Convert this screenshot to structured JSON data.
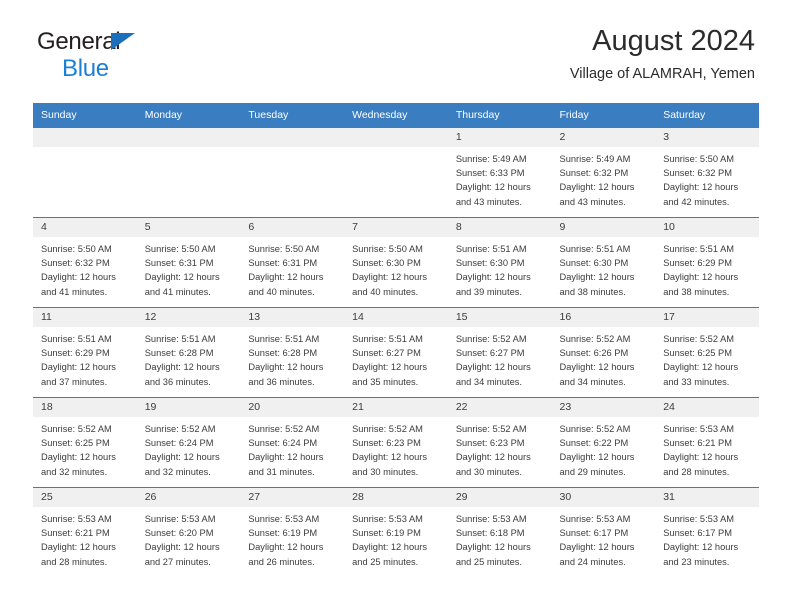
{
  "brand": {
    "name_part1": "General",
    "name_part2": "Blue",
    "accent_color": "#1c7fd6",
    "triangle_color": "#1c6fba"
  },
  "header": {
    "title": "August 2024",
    "subtitle": "Village of ALAMRAH, Yemen"
  },
  "calendar": {
    "header_bg": "#3a7dc0",
    "daynum_bg": "#f0f0f0",
    "weekday_headers": [
      "Sunday",
      "Monday",
      "Tuesday",
      "Wednesday",
      "Thursday",
      "Friday",
      "Saturday"
    ],
    "weeks": [
      [
        {
          "day": "",
          "sunrise": "",
          "sunset": "",
          "daylight1": "",
          "daylight2": "",
          "empty": true
        },
        {
          "day": "",
          "sunrise": "",
          "sunset": "",
          "daylight1": "",
          "daylight2": "",
          "empty": true
        },
        {
          "day": "",
          "sunrise": "",
          "sunset": "",
          "daylight1": "",
          "daylight2": "",
          "empty": true
        },
        {
          "day": "",
          "sunrise": "",
          "sunset": "",
          "daylight1": "",
          "daylight2": "",
          "empty": true
        },
        {
          "day": "1",
          "sunrise": "Sunrise: 5:49 AM",
          "sunset": "Sunset: 6:33 PM",
          "daylight1": "Daylight: 12 hours",
          "daylight2": "and 43 minutes.",
          "empty": false
        },
        {
          "day": "2",
          "sunrise": "Sunrise: 5:49 AM",
          "sunset": "Sunset: 6:32 PM",
          "daylight1": "Daylight: 12 hours",
          "daylight2": "and 43 minutes.",
          "empty": false
        },
        {
          "day": "3",
          "sunrise": "Sunrise: 5:50 AM",
          "sunset": "Sunset: 6:32 PM",
          "daylight1": "Daylight: 12 hours",
          "daylight2": "and 42 minutes.",
          "empty": false
        }
      ],
      [
        {
          "day": "4",
          "sunrise": "Sunrise: 5:50 AM",
          "sunset": "Sunset: 6:32 PM",
          "daylight1": "Daylight: 12 hours",
          "daylight2": "and 41 minutes.",
          "empty": false
        },
        {
          "day": "5",
          "sunrise": "Sunrise: 5:50 AM",
          "sunset": "Sunset: 6:31 PM",
          "daylight1": "Daylight: 12 hours",
          "daylight2": "and 41 minutes.",
          "empty": false
        },
        {
          "day": "6",
          "sunrise": "Sunrise: 5:50 AM",
          "sunset": "Sunset: 6:31 PM",
          "daylight1": "Daylight: 12 hours",
          "daylight2": "and 40 minutes.",
          "empty": false
        },
        {
          "day": "7",
          "sunrise": "Sunrise: 5:50 AM",
          "sunset": "Sunset: 6:30 PM",
          "daylight1": "Daylight: 12 hours",
          "daylight2": "and 40 minutes.",
          "empty": false
        },
        {
          "day": "8",
          "sunrise": "Sunrise: 5:51 AM",
          "sunset": "Sunset: 6:30 PM",
          "daylight1": "Daylight: 12 hours",
          "daylight2": "and 39 minutes.",
          "empty": false
        },
        {
          "day": "9",
          "sunrise": "Sunrise: 5:51 AM",
          "sunset": "Sunset: 6:30 PM",
          "daylight1": "Daylight: 12 hours",
          "daylight2": "and 38 minutes.",
          "empty": false
        },
        {
          "day": "10",
          "sunrise": "Sunrise: 5:51 AM",
          "sunset": "Sunset: 6:29 PM",
          "daylight1": "Daylight: 12 hours",
          "daylight2": "and 38 minutes.",
          "empty": false
        }
      ],
      [
        {
          "day": "11",
          "sunrise": "Sunrise: 5:51 AM",
          "sunset": "Sunset: 6:29 PM",
          "daylight1": "Daylight: 12 hours",
          "daylight2": "and 37 minutes.",
          "empty": false
        },
        {
          "day": "12",
          "sunrise": "Sunrise: 5:51 AM",
          "sunset": "Sunset: 6:28 PM",
          "daylight1": "Daylight: 12 hours",
          "daylight2": "and 36 minutes.",
          "empty": false
        },
        {
          "day": "13",
          "sunrise": "Sunrise: 5:51 AM",
          "sunset": "Sunset: 6:28 PM",
          "daylight1": "Daylight: 12 hours",
          "daylight2": "and 36 minutes.",
          "empty": false
        },
        {
          "day": "14",
          "sunrise": "Sunrise: 5:51 AM",
          "sunset": "Sunset: 6:27 PM",
          "daylight1": "Daylight: 12 hours",
          "daylight2": "and 35 minutes.",
          "empty": false
        },
        {
          "day": "15",
          "sunrise": "Sunrise: 5:52 AM",
          "sunset": "Sunset: 6:27 PM",
          "daylight1": "Daylight: 12 hours",
          "daylight2": "and 34 minutes.",
          "empty": false
        },
        {
          "day": "16",
          "sunrise": "Sunrise: 5:52 AM",
          "sunset": "Sunset: 6:26 PM",
          "daylight1": "Daylight: 12 hours",
          "daylight2": "and 34 minutes.",
          "empty": false
        },
        {
          "day": "17",
          "sunrise": "Sunrise: 5:52 AM",
          "sunset": "Sunset: 6:25 PM",
          "daylight1": "Daylight: 12 hours",
          "daylight2": "and 33 minutes.",
          "empty": false
        }
      ],
      [
        {
          "day": "18",
          "sunrise": "Sunrise: 5:52 AM",
          "sunset": "Sunset: 6:25 PM",
          "daylight1": "Daylight: 12 hours",
          "daylight2": "and 32 minutes.",
          "empty": false
        },
        {
          "day": "19",
          "sunrise": "Sunrise: 5:52 AM",
          "sunset": "Sunset: 6:24 PM",
          "daylight1": "Daylight: 12 hours",
          "daylight2": "and 32 minutes.",
          "empty": false
        },
        {
          "day": "20",
          "sunrise": "Sunrise: 5:52 AM",
          "sunset": "Sunset: 6:24 PM",
          "daylight1": "Daylight: 12 hours",
          "daylight2": "and 31 minutes.",
          "empty": false
        },
        {
          "day": "21",
          "sunrise": "Sunrise: 5:52 AM",
          "sunset": "Sunset: 6:23 PM",
          "daylight1": "Daylight: 12 hours",
          "daylight2": "and 30 minutes.",
          "empty": false
        },
        {
          "day": "22",
          "sunrise": "Sunrise: 5:52 AM",
          "sunset": "Sunset: 6:23 PM",
          "daylight1": "Daylight: 12 hours",
          "daylight2": "and 30 minutes.",
          "empty": false
        },
        {
          "day": "23",
          "sunrise": "Sunrise: 5:52 AM",
          "sunset": "Sunset: 6:22 PM",
          "daylight1": "Daylight: 12 hours",
          "daylight2": "and 29 minutes.",
          "empty": false
        },
        {
          "day": "24",
          "sunrise": "Sunrise: 5:53 AM",
          "sunset": "Sunset: 6:21 PM",
          "daylight1": "Daylight: 12 hours",
          "daylight2": "and 28 minutes.",
          "empty": false
        }
      ],
      [
        {
          "day": "25",
          "sunrise": "Sunrise: 5:53 AM",
          "sunset": "Sunset: 6:21 PM",
          "daylight1": "Daylight: 12 hours",
          "daylight2": "and 28 minutes.",
          "empty": false
        },
        {
          "day": "26",
          "sunrise": "Sunrise: 5:53 AM",
          "sunset": "Sunset: 6:20 PM",
          "daylight1": "Daylight: 12 hours",
          "daylight2": "and 27 minutes.",
          "empty": false
        },
        {
          "day": "27",
          "sunrise": "Sunrise: 5:53 AM",
          "sunset": "Sunset: 6:19 PM",
          "daylight1": "Daylight: 12 hours",
          "daylight2": "and 26 minutes.",
          "empty": false
        },
        {
          "day": "28",
          "sunrise": "Sunrise: 5:53 AM",
          "sunset": "Sunset: 6:19 PM",
          "daylight1": "Daylight: 12 hours",
          "daylight2": "and 25 minutes.",
          "empty": false
        },
        {
          "day": "29",
          "sunrise": "Sunrise: 5:53 AM",
          "sunset": "Sunset: 6:18 PM",
          "daylight1": "Daylight: 12 hours",
          "daylight2": "and 25 minutes.",
          "empty": false
        },
        {
          "day": "30",
          "sunrise": "Sunrise: 5:53 AM",
          "sunset": "Sunset: 6:17 PM",
          "daylight1": "Daylight: 12 hours",
          "daylight2": "and 24 minutes.",
          "empty": false
        },
        {
          "day": "31",
          "sunrise": "Sunrise: 5:53 AM",
          "sunset": "Sunset: 6:17 PM",
          "daylight1": "Daylight: 12 hours",
          "daylight2": "and 23 minutes.",
          "empty": false
        }
      ]
    ]
  }
}
